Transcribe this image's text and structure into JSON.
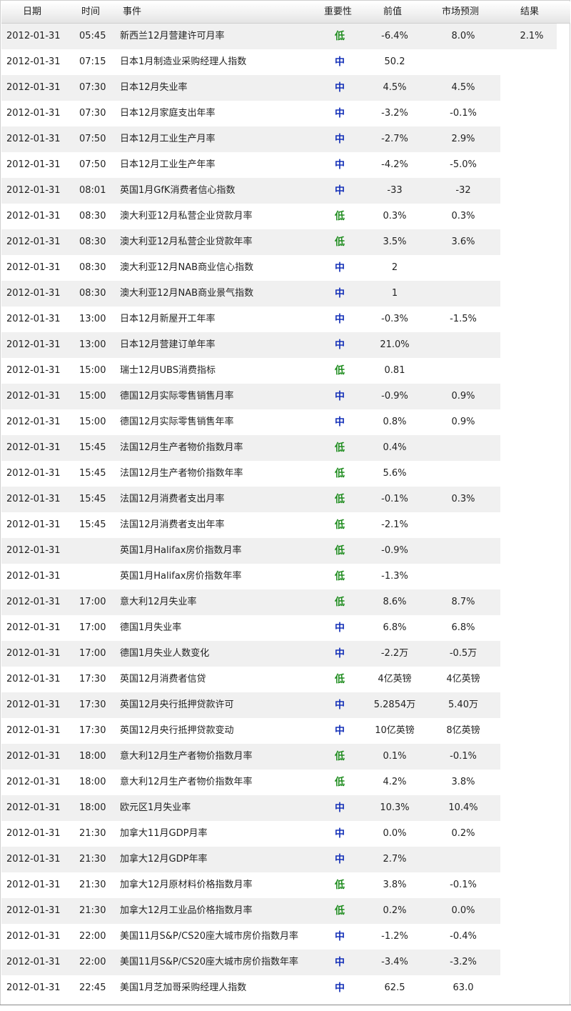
{
  "columns": {
    "date": "日期",
    "time": "时间",
    "event": "事件",
    "importance": "重要性",
    "previous": "前值",
    "forecast": "市场预测",
    "result": "结果"
  },
  "colors": {
    "low": "#1e8c1e",
    "medium": "#1531b8"
  },
  "rows": [
    {
      "date": "2012-01-31",
      "time": "05:45",
      "event": "新西兰12月营建许可月率",
      "importance": "低",
      "level": "low",
      "previous": "-6.4%",
      "forecast": "8.0%",
      "result": "2.1%"
    },
    {
      "date": "2012-01-31",
      "time": "07:15",
      "event": "日本1月制造业采购经理人指数",
      "importance": "中",
      "level": "medium",
      "previous": "50.2",
      "forecast": "",
      "result": ""
    },
    {
      "date": "2012-01-31",
      "time": "07:30",
      "event": "日本12月失业率",
      "importance": "中",
      "level": "medium",
      "previous": "4.5%",
      "forecast": "4.5%",
      "result": ""
    },
    {
      "date": "2012-01-31",
      "time": "07:30",
      "event": "日本12月家庭支出年率",
      "importance": "中",
      "level": "medium",
      "previous": "-3.2%",
      "forecast": "-0.1%",
      "result": ""
    },
    {
      "date": "2012-01-31",
      "time": "07:50",
      "event": "日本12月工业生产月率",
      "importance": "中",
      "level": "medium",
      "previous": "-2.7%",
      "forecast": "2.9%",
      "result": ""
    },
    {
      "date": "2012-01-31",
      "time": "07:50",
      "event": "日本12月工业生产年率",
      "importance": "中",
      "level": "medium",
      "previous": "-4.2%",
      "forecast": "-5.0%",
      "result": ""
    },
    {
      "date": "2012-01-31",
      "time": "08:01",
      "event": "英国1月GfK消费者信心指数",
      "importance": "中",
      "level": "medium",
      "previous": "-33",
      "forecast": "-32",
      "result": ""
    },
    {
      "date": "2012-01-31",
      "time": "08:30",
      "event": "澳大利亚12月私营企业贷款月率",
      "importance": "低",
      "level": "low",
      "previous": "0.3%",
      "forecast": "0.3%",
      "result": ""
    },
    {
      "date": "2012-01-31",
      "time": "08:30",
      "event": "澳大利亚12月私营企业贷款年率",
      "importance": "低",
      "level": "low",
      "previous": "3.5%",
      "forecast": "3.6%",
      "result": ""
    },
    {
      "date": "2012-01-31",
      "time": "08:30",
      "event": "澳大利亚12月NAB商业信心指数",
      "importance": "中",
      "level": "medium",
      "previous": "2",
      "forecast": "",
      "result": ""
    },
    {
      "date": "2012-01-31",
      "time": "08:30",
      "event": "澳大利亚12月NAB商业景气指数",
      "importance": "中",
      "level": "medium",
      "previous": "1",
      "forecast": "",
      "result": ""
    },
    {
      "date": "2012-01-31",
      "time": "13:00",
      "event": "日本12月新屋开工年率",
      "importance": "中",
      "level": "medium",
      "previous": "-0.3%",
      "forecast": "-1.5%",
      "result": ""
    },
    {
      "date": "2012-01-31",
      "time": "13:00",
      "event": "日本12月营建订单年率",
      "importance": "中",
      "level": "medium",
      "previous": "21.0%",
      "forecast": "",
      "result": ""
    },
    {
      "date": "2012-01-31",
      "time": "15:00",
      "event": "瑞士12月UBS消费指标",
      "importance": "低",
      "level": "low",
      "previous": "0.81",
      "forecast": "",
      "result": ""
    },
    {
      "date": "2012-01-31",
      "time": "15:00",
      "event": "德国12月实际零售销售月率",
      "importance": "中",
      "level": "medium",
      "previous": "-0.9%",
      "forecast": "0.9%",
      "result": ""
    },
    {
      "date": "2012-01-31",
      "time": "15:00",
      "event": "德国12月实际零售销售年率",
      "importance": "中",
      "level": "medium",
      "previous": "0.8%",
      "forecast": "0.9%",
      "result": ""
    },
    {
      "date": "2012-01-31",
      "time": "15:45",
      "event": "法国12月生产者物价指数月率",
      "importance": "低",
      "level": "low",
      "previous": "0.4%",
      "forecast": "",
      "result": ""
    },
    {
      "date": "2012-01-31",
      "time": "15:45",
      "event": "法国12月生产者物价指数年率",
      "importance": "低",
      "level": "low",
      "previous": "5.6%",
      "forecast": "",
      "result": ""
    },
    {
      "date": "2012-01-31",
      "time": "15:45",
      "event": "法国12月消费者支出月率",
      "importance": "低",
      "level": "low",
      "previous": "-0.1%",
      "forecast": "0.3%",
      "result": ""
    },
    {
      "date": "2012-01-31",
      "time": "15:45",
      "event": "法国12月消费者支出年率",
      "importance": "低",
      "level": "low",
      "previous": "-2.1%",
      "forecast": "",
      "result": ""
    },
    {
      "date": "2012-01-31",
      "time": "",
      "event": "英国1月Halifax房价指数月率",
      "importance": "低",
      "level": "low",
      "previous": "-0.9%",
      "forecast": "",
      "result": ""
    },
    {
      "date": "2012-01-31",
      "time": "",
      "event": "英国1月Halifax房价指数年率",
      "importance": "低",
      "level": "low",
      "previous": "-1.3%",
      "forecast": "",
      "result": ""
    },
    {
      "date": "2012-01-31",
      "time": "17:00",
      "event": "意大利12月失业率",
      "importance": "低",
      "level": "low",
      "previous": "8.6%",
      "forecast": "8.7%",
      "result": ""
    },
    {
      "date": "2012-01-31",
      "time": "17:00",
      "event": "德国1月失业率",
      "importance": "中",
      "level": "medium",
      "previous": "6.8%",
      "forecast": "6.8%",
      "result": ""
    },
    {
      "date": "2012-01-31",
      "time": "17:00",
      "event": "德国1月失业人数变化",
      "importance": "中",
      "level": "medium",
      "previous": "-2.2万",
      "forecast": "-0.5万",
      "result": ""
    },
    {
      "date": "2012-01-31",
      "time": "17:30",
      "event": "英国12月消费者信贷",
      "importance": "低",
      "level": "low",
      "previous": "4亿英镑",
      "forecast": "4亿英镑",
      "result": ""
    },
    {
      "date": "2012-01-31",
      "time": "17:30",
      "event": "英国12月央行抵押贷款许可",
      "importance": "中",
      "level": "medium",
      "previous": "5.2854万",
      "forecast": "5.40万",
      "result": ""
    },
    {
      "date": "2012-01-31",
      "time": "17:30",
      "event": "英国12月央行抵押贷款变动",
      "importance": "中",
      "level": "medium",
      "previous": "10亿英镑",
      "forecast": "8亿英镑",
      "result": ""
    },
    {
      "date": "2012-01-31",
      "time": "18:00",
      "event": "意大利12月生产者物价指数月率",
      "importance": "低",
      "level": "low",
      "previous": "0.1%",
      "forecast": "-0.1%",
      "result": ""
    },
    {
      "date": "2012-01-31",
      "time": "18:00",
      "event": "意大利12月生产者物价指数年率",
      "importance": "低",
      "level": "low",
      "previous": "4.2%",
      "forecast": "3.8%",
      "result": ""
    },
    {
      "date": "2012-01-31",
      "time": "18:00",
      "event": "欧元区1月失业率",
      "importance": "中",
      "level": "medium",
      "previous": "10.3%",
      "forecast": "10.4%",
      "result": ""
    },
    {
      "date": "2012-01-31",
      "time": "21:30",
      "event": "加拿大11月GDP月率",
      "importance": "中",
      "level": "medium",
      "previous": "0.0%",
      "forecast": "0.2%",
      "result": ""
    },
    {
      "date": "2012-01-31",
      "time": "21:30",
      "event": "加拿大12月GDP年率",
      "importance": "中",
      "level": "medium",
      "previous": "2.7%",
      "forecast": "",
      "result": ""
    },
    {
      "date": "2012-01-31",
      "time": "21:30",
      "event": "加拿大12月原材料价格指数月率",
      "importance": "低",
      "level": "low",
      "previous": "3.8%",
      "forecast": "-0.1%",
      "result": ""
    },
    {
      "date": "2012-01-31",
      "time": "21:30",
      "event": "加拿大12月工业品价格指数月率",
      "importance": "低",
      "level": "low",
      "previous": "0.2%",
      "forecast": "0.0%",
      "result": ""
    },
    {
      "date": "2012-01-31",
      "time": "22:00",
      "event": "美国11月S&P/CS20座大城市房价指数月率",
      "importance": "中",
      "level": "medium",
      "previous": "-1.2%",
      "forecast": "-0.4%",
      "result": ""
    },
    {
      "date": "2012-01-31",
      "time": "22:00",
      "event": "美国11月S&P/CS20座大城市房价指数年率",
      "importance": "中",
      "level": "medium",
      "previous": "-3.4%",
      "forecast": "-3.2%",
      "result": ""
    },
    {
      "date": "2012-01-31",
      "time": "22:45",
      "event": "美国1月芝加哥采购经理人指数",
      "importance": "中",
      "level": "medium",
      "previous": "62.5",
      "forecast": "63.0",
      "result": ""
    }
  ]
}
